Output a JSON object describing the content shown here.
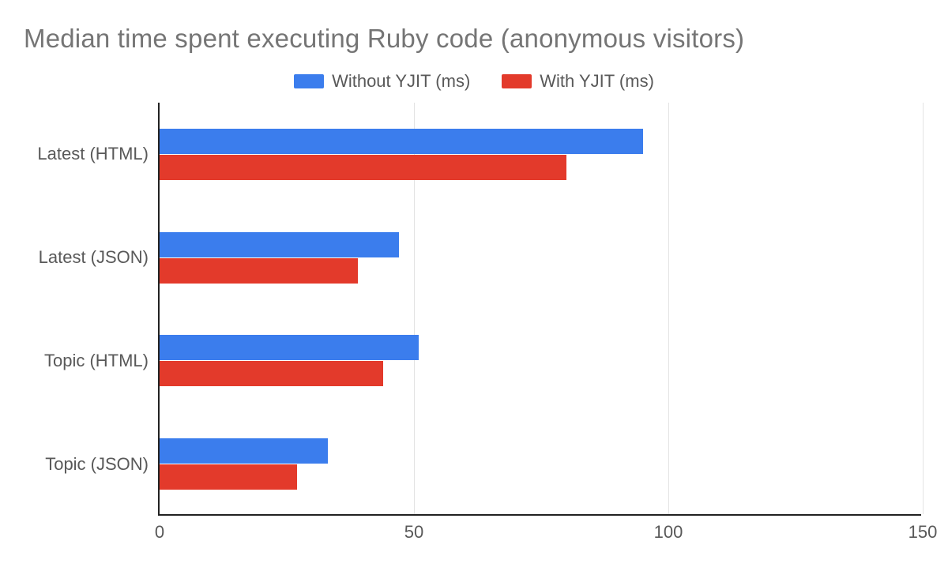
{
  "chart_data": {
    "type": "bar",
    "orientation": "horizontal",
    "title": "Median time spent executing Ruby code (anonymous visitors)",
    "xlabel": "",
    "ylabel": "",
    "categories": [
      "Latest (HTML)",
      "Latest (JSON)",
      "Topic (HTML)",
      "Topic (JSON)"
    ],
    "series": [
      {
        "name": "Without YJIT (ms)",
        "color": "#3b7ded",
        "values": [
          95,
          47,
          51,
          33
        ]
      },
      {
        "name": "With YJIT (ms)",
        "color": "#e33a2b",
        "values": [
          80,
          39,
          44,
          27
        ]
      }
    ],
    "xlim": [
      0,
      150
    ],
    "xticks": [
      0,
      50,
      100,
      150
    ],
    "grid": true,
    "legend_position": "top"
  }
}
